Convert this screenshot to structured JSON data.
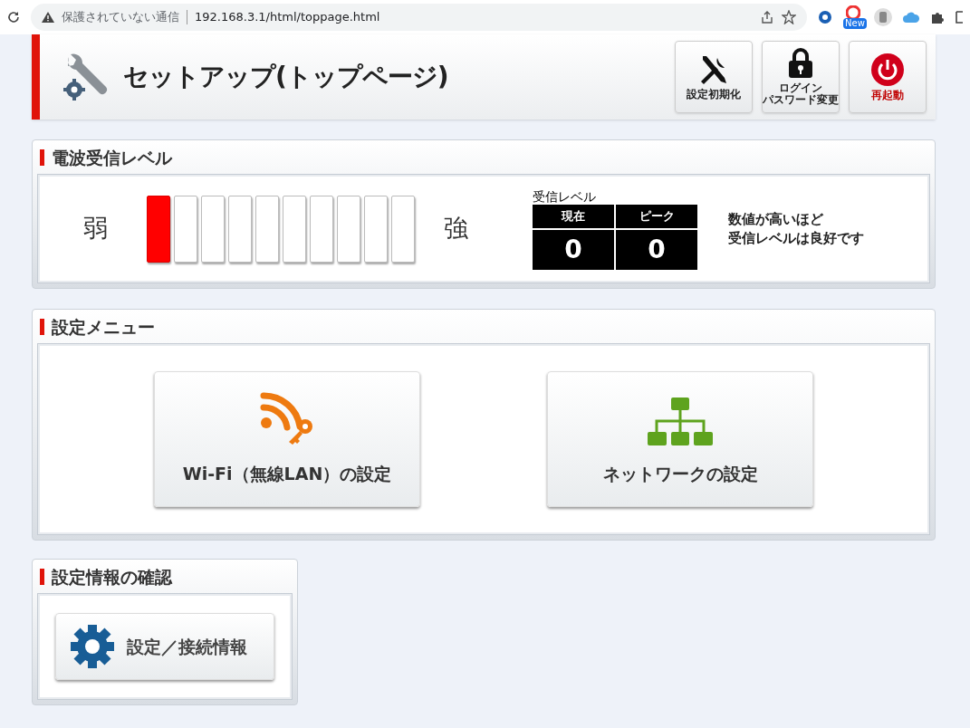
{
  "browser": {
    "security": "保護されていない通信",
    "url": "192.168.3.1/html/toppage.html",
    "badge": "New"
  },
  "header": {
    "title": "セットアップ(トップページ)",
    "buttons": [
      {
        "kind": "reset",
        "label": "設定初期化"
      },
      {
        "kind": "password",
        "label": [
          "ログイン",
          "パスワード変更"
        ]
      },
      {
        "kind": "reboot",
        "label": "再起動"
      }
    ]
  },
  "signal": {
    "title": "電波受信レベル",
    "weak": "弱",
    "strong": "強",
    "segments": [
      {
        "on": true
      },
      {
        "on": false
      },
      {
        "on": false
      },
      {
        "on": false
      },
      {
        "on": false
      },
      {
        "on": false
      },
      {
        "on": false
      },
      {
        "on": false
      },
      {
        "on": false
      },
      {
        "on": false
      }
    ],
    "reading_title": "受信レベル",
    "columns": [
      "現在",
      "ピーク"
    ],
    "values": [
      "0",
      "0"
    ],
    "note": [
      "数値が高いほど",
      "受信レベルは良好です"
    ]
  },
  "menu": {
    "title": "設定メニュー",
    "buttons": [
      {
        "kind": "wifi",
        "label": "Wi-Fi（無線LAN）の設定"
      },
      {
        "kind": "network",
        "label": "ネットワークの設定"
      }
    ]
  },
  "info": {
    "title": "設定情報の確認",
    "button": {
      "kind": "gear",
      "label": "設定／接続情報"
    }
  }
}
